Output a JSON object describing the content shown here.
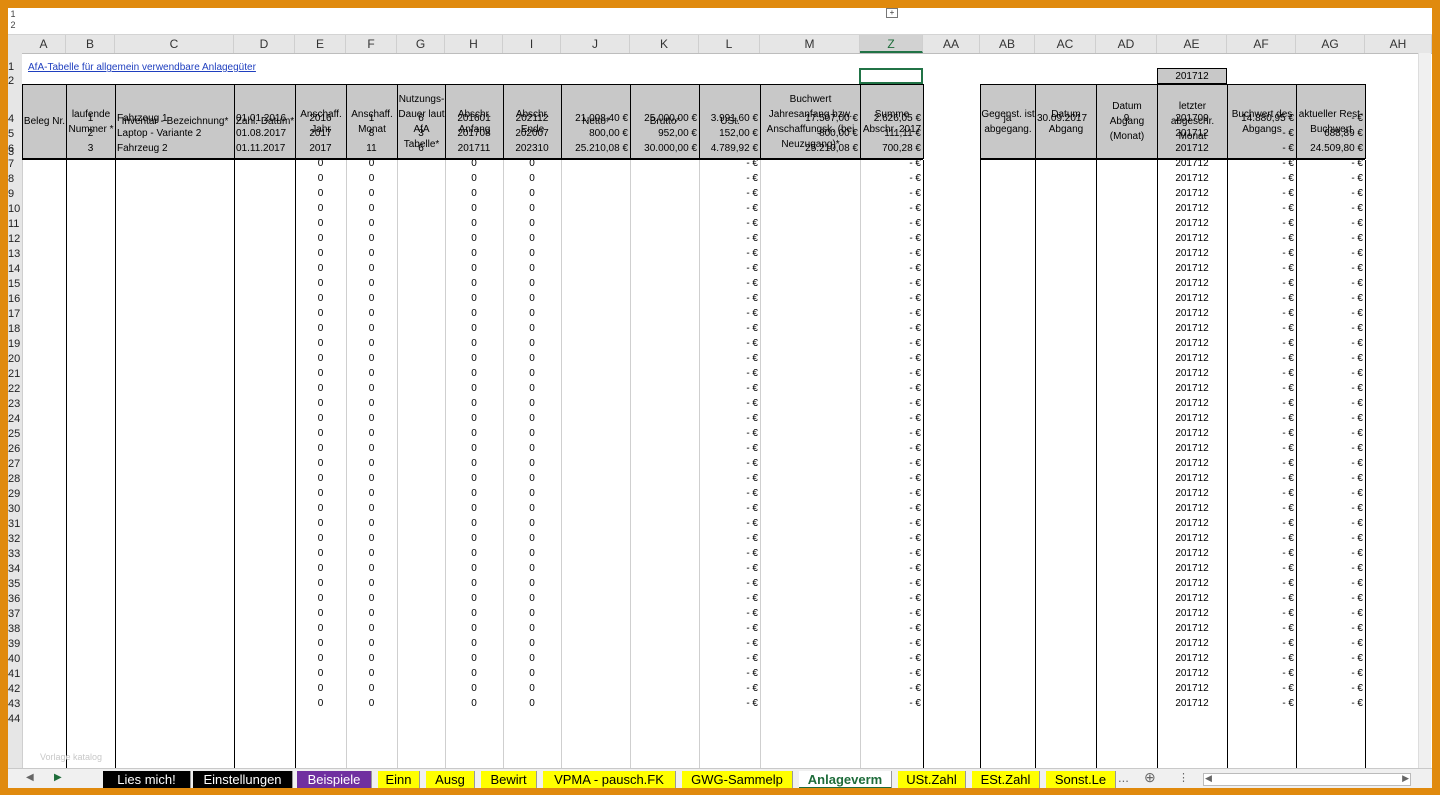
{
  "sheet": {
    "title_link": "AfA-Tabelle für allgemein verwendbare Anlagegüter",
    "ae_header_value": "201712",
    "outline_levels": [
      "1",
      "2"
    ],
    "columns": [
      "A",
      "B",
      "C",
      "D",
      "E",
      "F",
      "G",
      "H",
      "I",
      "J",
      "K",
      "L",
      "M",
      "Z",
      "AA",
      "AB",
      "AC",
      "AD",
      "AE",
      "AF",
      "AG",
      "AH"
    ],
    "selected_column": "Z",
    "headers": {
      "A": "Beleg Nr.",
      "B": "laufende Nummer *",
      "C": "Inventar - Bezeichnung*",
      "D": "Zahl. Datum*",
      "E": "Anschaff. Jahr",
      "F": "Anschaff. Monat",
      "G": "Nutzungs-Dauer laut AfA Tabelle*",
      "H": "Abschr. Anfang",
      "I": "Abschr. Ende",
      "J": "Netto*",
      "K": "Brutto*",
      "L": "USt.",
      "M": "Buchwert Jahresanfang bzw. Anschaffungsk. (bei Neuzugang)*",
      "Z": "Summe Abschr. 2017",
      "AB": "Gegenst. ist abgegang.",
      "AC": "Datum Abgang",
      "AD": "Datum Abgang (Monat)",
      "AE": "letzter abgeschr. Monat",
      "AF": "Buchwert des Abgangs",
      "AG": "aktueller Rest-Buchwert"
    },
    "rows": [
      {
        "row": "4",
        "B": "1",
        "C": "Fahrzeug 1",
        "D": "01.01.2016",
        "E": "2016",
        "F": "1",
        "G": "6",
        "H": "201601",
        "I": "202112",
        "J": "21.008,40 €",
        "K": "25.000,00 €",
        "L": "3.991,60 €",
        "M": "17.507,00 €",
        "Z": "2.626,05 €",
        "AB": "ja",
        "AC": "30.09.2017",
        "AD": "9",
        "AE": "201709",
        "AF": "14.880,95 €",
        "AG": "-   €"
      },
      {
        "row": "5",
        "B": "2",
        "C": "Laptop - Variante 2",
        "D": "01.08.2017",
        "E": "2017",
        "F": "8",
        "G": "3",
        "H": "201708",
        "I": "202007",
        "J": "800,00 €",
        "K": "952,00 €",
        "L": "152,00 €",
        "M": "800,00 €",
        "Z": "111,11 €",
        "AE": "201712",
        "AF": "-   €",
        "AG": "688,89 €"
      },
      {
        "row": "6",
        "B": "3",
        "C": "Fahrzeug 2",
        "D": "01.11.2017",
        "E": "2017",
        "F": "11",
        "G": "6",
        "H": "201711",
        "I": "202310",
        "J": "25.210,08 €",
        "K": "30.000,00 €",
        "L": "4.789,92 €",
        "M": "25.210,08 €",
        "Z": "700,28 €",
        "AE": "201712",
        "AF": "-   €",
        "AG": "24.509,80 €"
      }
    ],
    "empty_row_values": {
      "E": "0",
      "F": "0",
      "H": "0",
      "I": "0",
      "L": "-   €",
      "Z": "-   €",
      "AE": "201712",
      "AF": "-   €",
      "AG": "-   €"
    },
    "empty_rows_first": 7,
    "empty_rows_last": 43,
    "partial_row_label": "44",
    "watermark": "Vorlage katalog"
  },
  "tabs": [
    {
      "label": "Lies mich!",
      "bg": "#000000",
      "fg": "#ffffff"
    },
    {
      "label": "Einstellungen",
      "bg": "#000000",
      "fg": "#ffffff"
    },
    {
      "label": "Beispiele",
      "bg": "#7030a0",
      "fg": "#ffffff"
    },
    {
      "label": "Einn",
      "bg": "#ffff00",
      "fg": "#000000"
    },
    {
      "label": "Ausg",
      "bg": "#ffff00",
      "fg": "#000000"
    },
    {
      "label": "Bewirt",
      "bg": "#ffff00",
      "fg": "#000000"
    },
    {
      "label": "VPMA - pausch.FK",
      "bg": "#ffff00",
      "fg": "#000000"
    },
    {
      "label": "GWG-Sammelp",
      "bg": "#ffff00",
      "fg": "#000000"
    },
    {
      "label": "Anlageverm",
      "bg": "#ffffff",
      "fg": "#1e6c3a",
      "active": true
    },
    {
      "label": "USt.Zahl",
      "bg": "#ffff00",
      "fg": "#000000"
    },
    {
      "label": "ESt.Zahl",
      "bg": "#ffff00",
      "fg": "#000000"
    },
    {
      "label": "Sonst.Le",
      "bg": "#ffff00",
      "fg": "#000000"
    }
  ],
  "tab_overflow": "...",
  "add_sheet_icon": "plus-circle-icon"
}
